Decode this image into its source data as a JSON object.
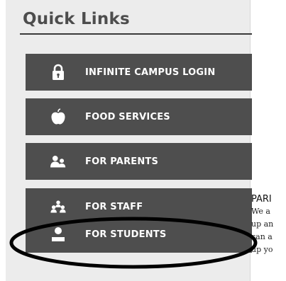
{
  "quick_links": {
    "title": "Quick Links",
    "items": [
      {
        "label": "INFINITE CAMPUS LOGIN",
        "icon": "lock-icon"
      },
      {
        "label": "FOOD SERVICES",
        "icon": "apple-icon"
      },
      {
        "label": "FOR PARENTS",
        "icon": "parents-icon"
      },
      {
        "label": "FOR STAFF",
        "icon": "staff-icon"
      },
      {
        "label": "FOR STUDENTS",
        "icon": "student-icon"
      }
    ]
  },
  "content_preview": {
    "heading": "PARI",
    "lines": [
      "We a",
      "up an",
      "can a",
      "up yo"
    ]
  },
  "colors": {
    "button_bg": "#4e4e4e",
    "button_text": "#ffffff",
    "sidebar_bg": "#ececec",
    "title_text": "#4d4d4d",
    "highlight_oval": "#000000"
  }
}
